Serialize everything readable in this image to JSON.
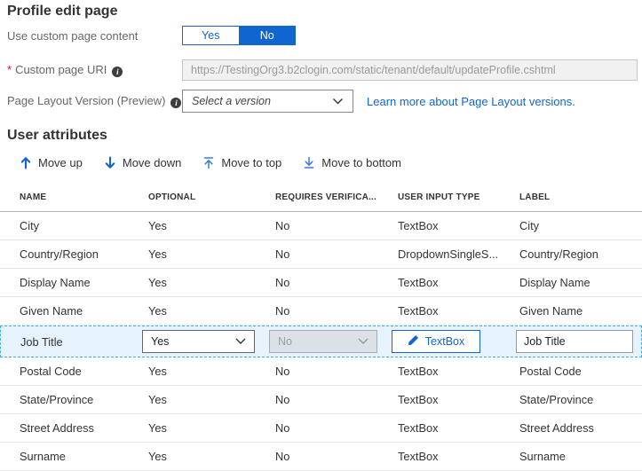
{
  "title": "Profile edit page",
  "toggle": {
    "label": "Use custom page content",
    "options": [
      "Yes",
      "No"
    ],
    "selected": "No"
  },
  "uri": {
    "required_mark": "*",
    "label": "Custom page URI",
    "value": "https://TestingOrg3.b2clogin.com/static/tenant/default/updateProfile.cshtml"
  },
  "layout_version": {
    "label": "Page Layout Version (Preview)",
    "placeholder": "Select a version",
    "link_text": "Learn more about Page Layout versions."
  },
  "attributes": {
    "heading": "User attributes",
    "toolbar": {
      "move_up": "Move up",
      "move_down": "Move down",
      "move_to_top": "Move to top",
      "move_to_bottom": "Move to bottom"
    },
    "columns": [
      "NAME",
      "OPTIONAL",
      "REQUIRES VERIFICA...",
      "USER INPUT TYPE",
      "LABEL"
    ],
    "rows": [
      {
        "name": "City",
        "optional": "Yes",
        "requires_verification": "No",
        "user_input_type": "TextBox",
        "label": "City"
      },
      {
        "name": "Country/Region",
        "optional": "Yes",
        "requires_verification": "No",
        "user_input_type": "DropdownSingleS...",
        "label": "Country/Region"
      },
      {
        "name": "Display Name",
        "optional": "Yes",
        "requires_verification": "No",
        "user_input_type": "TextBox",
        "label": "Display Name"
      },
      {
        "name": "Given Name",
        "optional": "Yes",
        "requires_verification": "No",
        "user_input_type": "TextBox",
        "label": "Given Name"
      },
      {
        "name": "Job Title",
        "optional": "Yes",
        "requires_verification": "No",
        "user_input_type": "TextBox",
        "label": "Job Title",
        "editing": true
      },
      {
        "name": "Postal Code",
        "optional": "Yes",
        "requires_verification": "No",
        "user_input_type": "TextBox",
        "label": "Postal Code"
      },
      {
        "name": "State/Province",
        "optional": "Yes",
        "requires_verification": "No",
        "user_input_type": "TextBox",
        "label": "State/Province"
      },
      {
        "name": "Street Address",
        "optional": "Yes",
        "requires_verification": "No",
        "user_input_type": "TextBox",
        "label": "Street Address"
      },
      {
        "name": "Surname",
        "optional": "Yes",
        "requires_verification": "No",
        "user_input_type": "TextBox",
        "label": "Surname"
      }
    ]
  },
  "colors": {
    "accent_blue": "#1065d0",
    "link_blue": "#1065d0",
    "required_red": "#e81123",
    "selected_row_bg": "#e6f3fc",
    "selected_row_border": "#45b0e6",
    "disabled_input_bg": "#f1f1f1",
    "disabled_select_bg": "#dce1e7"
  }
}
